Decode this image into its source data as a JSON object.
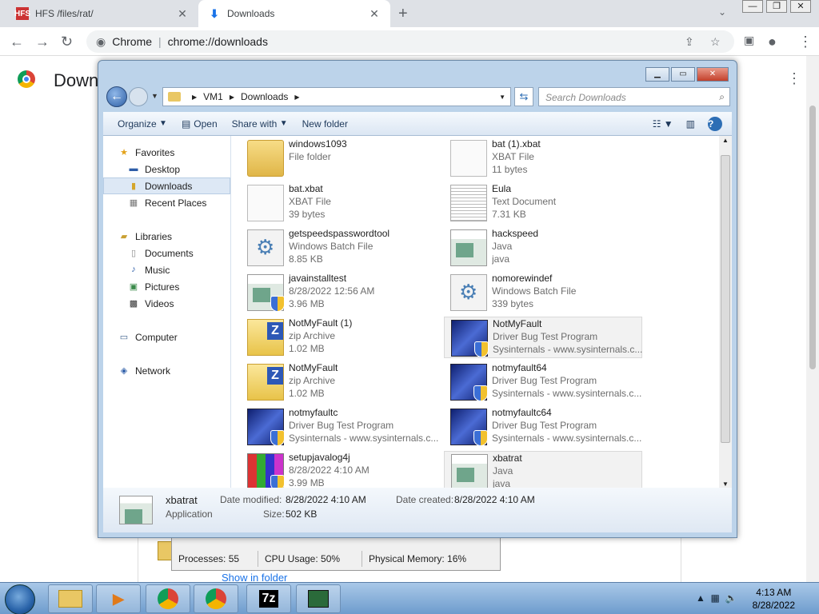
{
  "browser": {
    "tabs": [
      {
        "title": "HFS /files/rat/",
        "icon": "HFS"
      },
      {
        "title": "Downloads",
        "icon": "download-icon"
      }
    ],
    "url_origin": "Chrome",
    "url": "chrome://downloads",
    "page_title": "Downl",
    "show_in_folder": "Show in folder"
  },
  "taskmgr": {
    "processes": "Processes: 55",
    "cpu": "CPU Usage: 50%",
    "memory": "Physical Memory: 16%"
  },
  "explorer": {
    "path": [
      "VM1",
      "Downloads"
    ],
    "search_placeholder": "Search Downloads",
    "toolbar": {
      "organize": "Organize",
      "open": "Open",
      "share": "Share with",
      "newfolder": "New folder"
    },
    "nav": {
      "favorites": "Favorites",
      "desktop": "Desktop",
      "downloads": "Downloads",
      "recent": "Recent Places",
      "libraries": "Libraries",
      "documents": "Documents",
      "music": "Music",
      "pictures": "Pictures",
      "videos": "Videos",
      "computer": "Computer",
      "network": "Network"
    },
    "files": [
      {
        "name": "windows1093",
        "l1": "File folder",
        "l2": "",
        "icon": "folder"
      },
      {
        "name": "bat (1).xbat",
        "l1": "XBAT File",
        "l2": "11 bytes",
        "icon": "doc"
      },
      {
        "name": "bat.xbat",
        "l1": "XBAT File",
        "l2": "39 bytes",
        "icon": "doc"
      },
      {
        "name": "Eula",
        "l1": "Text Document",
        "l2": "7.31 KB",
        "icon": "txt"
      },
      {
        "name": "getspeedspasswordtool",
        "l1": "Windows Batch File",
        "l2": "8.85 KB",
        "icon": "gear"
      },
      {
        "name": "hackspeed",
        "l1": "Java",
        "l2": "java",
        "icon": "java"
      },
      {
        "name": "javainstalltest",
        "l1": "8/28/2022 12:56 AM",
        "l2": "3.96 MB",
        "icon": "java-shield"
      },
      {
        "name": "nomorewindef",
        "l1": "Windows Batch File",
        "l2": "339 bytes",
        "icon": "gear"
      },
      {
        "name": "NotMyFault (1)",
        "l1": "zip Archive",
        "l2": "1.02 MB",
        "icon": "zip"
      },
      {
        "name": "NotMyFault",
        "l1": "Driver Bug Test Program",
        "l2": "Sysinternals - www.sysinternals.c...",
        "icon": "sys"
      },
      {
        "name": "NotMyFault",
        "l1": "zip Archive",
        "l2": "1.02 MB",
        "icon": "zip"
      },
      {
        "name": "notmyfault64",
        "l1": "Driver Bug Test Program",
        "l2": "Sysinternals - www.sysinternals.c...",
        "icon": "sys"
      },
      {
        "name": "notmyfaultc",
        "l1": "Driver Bug Test Program",
        "l2": "Sysinternals - www.sysinternals.c...",
        "icon": "sys"
      },
      {
        "name": "notmyfaultc64",
        "l1": "Driver Bug Test Program",
        "l2": "Sysinternals - www.sysinternals.c...",
        "icon": "sys"
      },
      {
        "name": "setupjavalog4j",
        "l1": "8/28/2022 4:10 AM",
        "l2": "3.99 MB",
        "icon": "setup"
      },
      {
        "name": "xbatrat",
        "l1": "Java",
        "l2": "java",
        "icon": "java"
      }
    ],
    "status": {
      "name": "xbatrat",
      "type": "Application",
      "mod_label": "Date modified:",
      "mod": "8/28/2022 4:10 AM",
      "created_label": "Date created:",
      "created": "8/28/2022 4:10 AM",
      "size_label": "Size:",
      "size": "502 KB"
    }
  },
  "taskbar": {
    "items": [
      "explorer",
      "media",
      "chrome",
      "chrome",
      "7z",
      "taskmgr"
    ],
    "time": "4:13 AM",
    "date": "8/28/2022"
  }
}
